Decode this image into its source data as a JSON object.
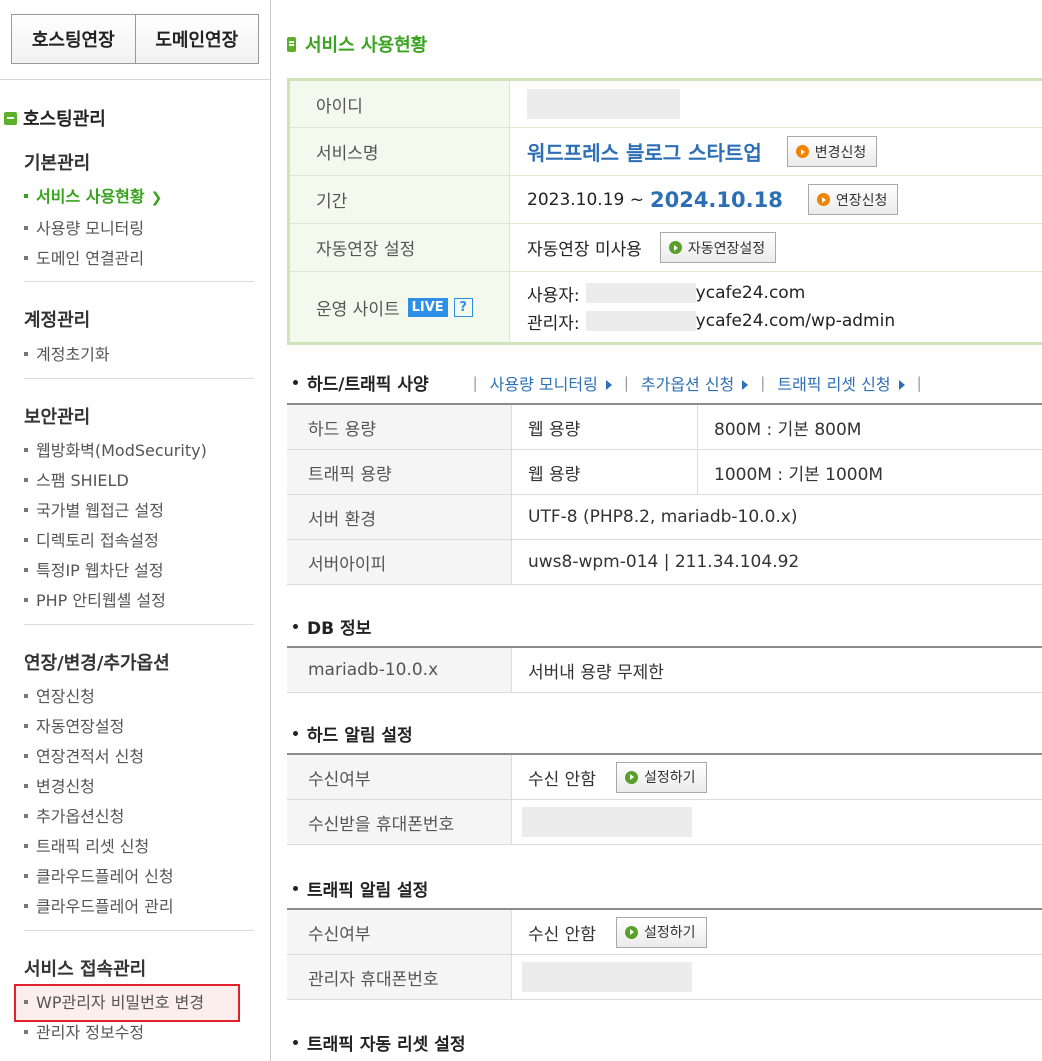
{
  "sidebar": {
    "top_buttons": [
      "호스팅연장",
      "도메인연장"
    ],
    "title": "호스팅관리",
    "groups": [
      {
        "title": "기본관리",
        "items": [
          "서비스 사용현황",
          "사용량 모니터링",
          "도메인 연결관리"
        ]
      },
      {
        "title": "계정관리",
        "items": [
          "계정초기화"
        ]
      },
      {
        "title": "보안관리",
        "items": [
          "웹방화벽(ModSecurity)",
          "스팸 SHIELD",
          "국가별 웹접근 설정",
          "디렉토리 접속설정",
          "특정IP 웹차단 설정",
          "PHP 안티웹셸 설정"
        ]
      },
      {
        "title": "연장/변경/추가옵션",
        "items": [
          "연장신청",
          "자동연장설정",
          "연장견적서 신청",
          "변경신청",
          "추가옵션신청",
          "트래픽 리셋 신청",
          "클라우드플레어 신청",
          "클라우드플레어 관리"
        ]
      },
      {
        "title": "서비스 접속관리",
        "items": [
          "WP관리자 비밀번호 변경",
          "관리자 정보수정"
        ]
      }
    ],
    "active_item": "서비스 사용현황",
    "highlighted_item": "WP관리자 비밀번호 변경"
  },
  "page": {
    "title": "서비스 사용현황"
  },
  "service": {
    "id_label": "아이디",
    "name_label": "서비스명",
    "name_value": "워드프레스 블로그 스타트업",
    "change_btn": "변경신청",
    "period_label": "기간",
    "period_start": "2023.10.19 ~",
    "period_end": "2024.10.18",
    "extend_btn": "연장신청",
    "auto_label": "자동연장 설정",
    "auto_value": "자동연장 미사용",
    "auto_btn": "자동연장설정",
    "site_label": "운영 사이트",
    "live_badge": "LIVE",
    "help": "?",
    "user_prefix": "사용자:",
    "user_suffix": "ycafe24.com",
    "admin_prefix": "관리자:",
    "admin_suffix": "ycafe24.com/wp-admin"
  },
  "hard_traffic": {
    "heading": "하드/트래픽 사양",
    "links": [
      "사용량 모니터링",
      "추가옵션 신청",
      "트래픽 리셋 신청"
    ],
    "rows": [
      {
        "label": "하드 용량",
        "type": "웹 용량",
        "value": "800M : 기본 800M"
      },
      {
        "label": "트래픽 용량",
        "type": "웹 용량",
        "value": "1000M : 기본 1000M"
      },
      {
        "label": "서버 환경",
        "value": "UTF-8 (PHP8.2, mariadb-10.0.x)"
      },
      {
        "label": "서버아이피",
        "value": "uws8-wpm-014 | 211.34.104.92"
      }
    ]
  },
  "db": {
    "heading": "DB 정보",
    "label": "mariadb-10.0.x",
    "value": "서버내 용량 무제한"
  },
  "hard_alert": {
    "heading": "하드 알림 설정",
    "recv_label": "수신여부",
    "recv_value": "수신 안함",
    "btn": "설정하기",
    "phone_label": "수신받을 휴대폰번호"
  },
  "traffic_alert": {
    "heading": "트래픽 알림 설정",
    "recv_label": "수신여부",
    "recv_value": "수신 안함",
    "btn": "설정하기",
    "phone_label": "관리자 휴대폰번호"
  },
  "traffic_reset": {
    "heading": "트래픽 자동 리셋 설정"
  },
  "colors": {
    "accent_green": "#3aa31f",
    "link_blue": "#2d6fb5",
    "highlight_red": "#e0232b",
    "badge_blue": "#2d8fe6",
    "orange": "#f08300"
  }
}
